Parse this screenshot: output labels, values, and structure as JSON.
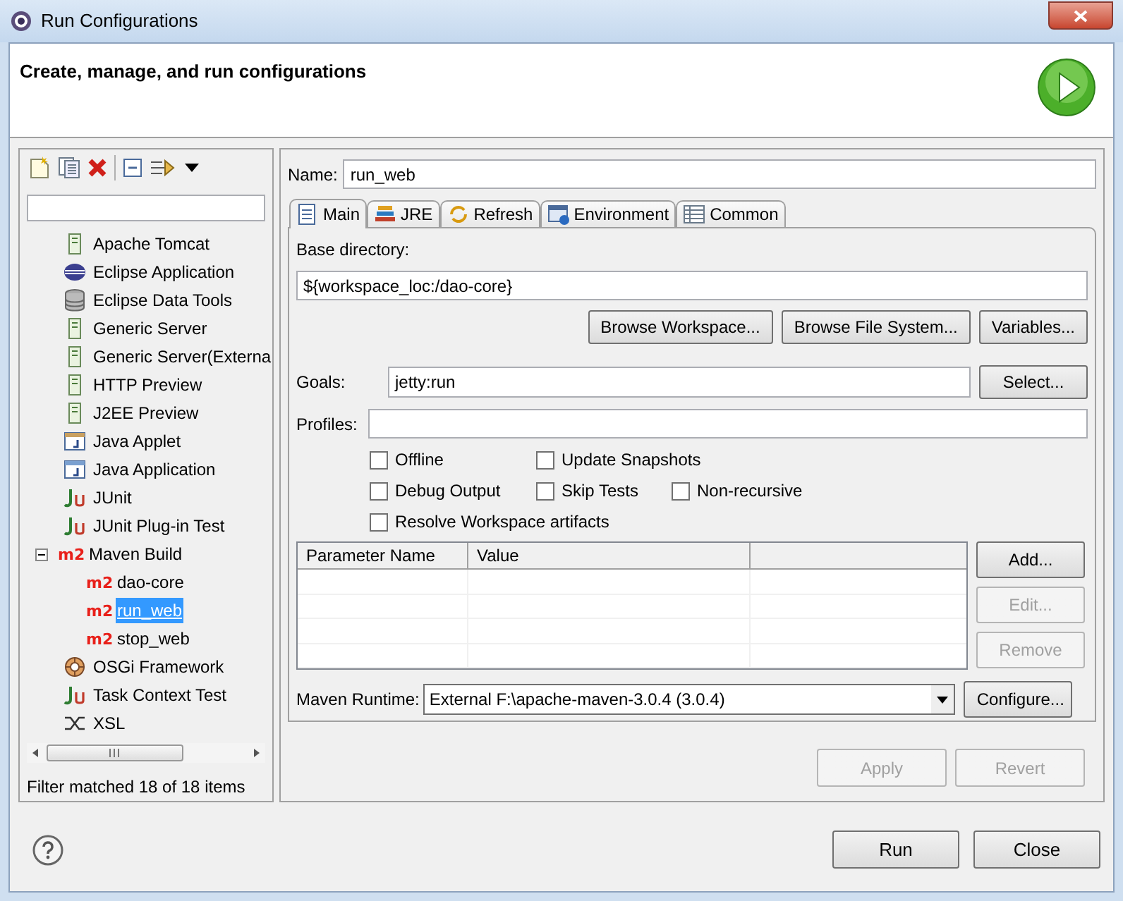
{
  "window": {
    "title": "Run Configurations"
  },
  "header": {
    "title": "Create, manage, and run configurations"
  },
  "sidebar": {
    "tree": [
      {
        "label": "Apache Tomcat",
        "kind": "server",
        "selected": false
      },
      {
        "label": "Eclipse Application",
        "kind": "eclipse",
        "selected": false
      },
      {
        "label": "Eclipse Data Tools",
        "kind": "database",
        "selected": false
      },
      {
        "label": "Generic Server",
        "kind": "server",
        "selected": false
      },
      {
        "label": "Generic Server(Externa",
        "kind": "server",
        "selected": false
      },
      {
        "label": "HTTP Preview",
        "kind": "server",
        "selected": false
      },
      {
        "label": "J2EE Preview",
        "kind": "server",
        "selected": false
      },
      {
        "label": "Java Applet",
        "kind": "applet",
        "selected": false
      },
      {
        "label": "Java Application",
        "kind": "javaapp",
        "selected": false
      },
      {
        "label": "JUnit",
        "kind": "junit",
        "selected": false
      },
      {
        "label": "JUnit Plug-in Test",
        "kind": "junit",
        "selected": false
      },
      {
        "label": "Maven Build",
        "kind": "maven",
        "icon_text": "m2",
        "selected": false,
        "expanded": true,
        "children": [
          {
            "label": "dao-core",
            "kind": "maven",
            "icon_text": "m2",
            "selected": false
          },
          {
            "label": "run_web",
            "kind": "maven",
            "icon_text": "m2",
            "selected": true
          },
          {
            "label": "stop_web",
            "kind": "maven",
            "icon_text": "m2",
            "selected": false
          }
        ]
      },
      {
        "label": "OSGi Framework",
        "kind": "osgi",
        "selected": false
      },
      {
        "label": "Task Context Test",
        "kind": "junit",
        "selected": false
      },
      {
        "label": "XSL",
        "kind": "xsl",
        "selected": false
      }
    ],
    "status": "Filter matched 18 of 18 items"
  },
  "name": {
    "label": "Name:",
    "value": "run_web"
  },
  "tabs": [
    {
      "label": "Main",
      "selected": true
    },
    {
      "label": "JRE",
      "selected": false
    },
    {
      "label": "Refresh",
      "selected": false
    },
    {
      "label": "Environment",
      "selected": false
    },
    {
      "label": "Common",
      "selected": false
    }
  ],
  "main": {
    "base_directory": {
      "label": "Base directory:",
      "value": "${workspace_loc:/dao-core}"
    },
    "base_buttons": [
      {
        "label": "Browse Workspace...",
        "disabled": false
      },
      {
        "label": "Browse File System...",
        "disabled": false
      },
      {
        "label": "Variables...",
        "disabled": false
      }
    ],
    "goals": {
      "label": "Goals:",
      "value": "jetty:run",
      "button": "Select..."
    },
    "profiles": {
      "label": "Profiles:"
    },
    "options": [
      [
        {
          "label": "Offline",
          "checked": false
        },
        {
          "label": "Update Snapshots",
          "checked": false
        }
      ],
      [
        {
          "label": "Debug Output",
          "checked": false
        },
        {
          "label": "Skip Tests",
          "checked": false
        },
        {
          "label": "Non-recursive",
          "checked": false
        }
      ],
      [
        {
          "label": "Resolve Workspace artifacts",
          "checked": false
        }
      ]
    ],
    "table": {
      "columns": [
        "Parameter Name",
        "Value"
      ]
    },
    "table_buttons": [
      {
        "label": "Add...",
        "disabled": false
      },
      {
        "label": "Edit...",
        "disabled": true
      },
      {
        "label": "Remove",
        "disabled": true
      }
    ],
    "runtime": {
      "label": "Maven Runtime:",
      "value": "External F:\\apache-maven-3.0.4 (3.0.4)",
      "button": "Configure..."
    }
  },
  "apply_buttons": [
    {
      "label": "Apply",
      "disabled": true
    },
    {
      "label": "Revert",
      "disabled": true
    }
  ],
  "footer_buttons": [
    {
      "label": "Run",
      "disabled": false
    },
    {
      "label": "Close",
      "disabled": false
    }
  ]
}
